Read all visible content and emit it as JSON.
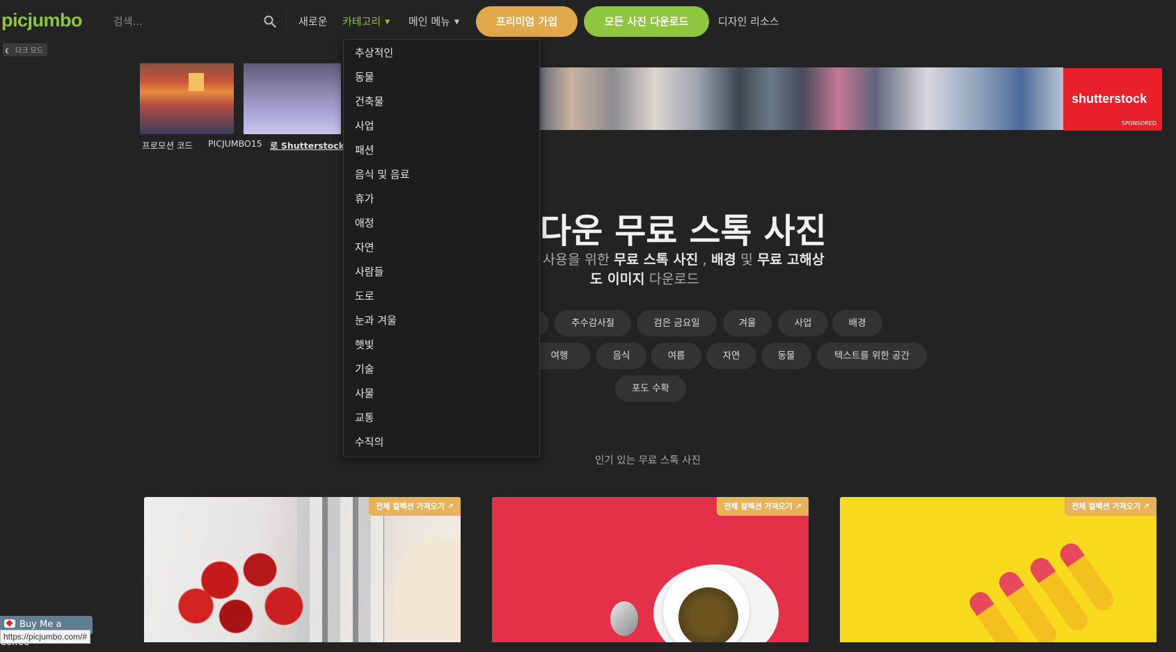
{
  "header": {
    "logo": "picjumbo",
    "dark_mode_label": "다크 모드",
    "search_placeholder": "검색...",
    "nav": {
      "new": "새로운",
      "categories": "카테고리",
      "main_menu": "메인 메뉴",
      "design_resources": "디자인 리소스"
    },
    "premium_button": "프리미엄 가입",
    "download_all_button": "모든 사진 다운로드"
  },
  "promo": {
    "labels": [
      "프로모션 코드",
      "PICJUMBO15",
      "로 Shutterstock에"
    ],
    "shutterstock_logo": "shutterstock",
    "sponsored": "SPONSORED"
  },
  "hero": {
    "title": "다운 무료 스톡 사진",
    "subtitle_parts": [
      "사용을 위한",
      "무료 스톡 사진",
      ",",
      "배경",
      "및",
      "무료 고해상",
      "도 이미지",
      "다운로드"
    ]
  },
  "tags": {
    "row1": [
      "추수감사절",
      "검은 금요일",
      "겨울",
      "사업",
      "배경"
    ],
    "row2": [
      "여행",
      "음식",
      "여름",
      "자연",
      "동물",
      "텍스트를 위한 공간"
    ],
    "row3": [
      "포도 수확"
    ]
  },
  "popular_heading": "인기 있는 무료 스톡 사진",
  "cards": [
    {
      "badge": "전체 컬렉션 가져오기"
    },
    {
      "badge": "전체 컬렉션 가져오기"
    },
    {
      "badge": "전체 컬렉션 가져오기"
    }
  ],
  "category_menu": [
    "추상적인",
    "동물",
    "건축물",
    "사업",
    "패션",
    "음식 및 음료",
    "휴가",
    "애정",
    "자연",
    "사람들",
    "도로",
    "눈과 겨울",
    "햇빛",
    "기술",
    "사물",
    "교통",
    "수직의"
  ],
  "footer": {
    "coffee": "Buy Me a Coffee",
    "status_url": "https://picjumbo.com/#"
  },
  "colors": {
    "background": "#232323",
    "accent_green": "#8ec63f",
    "premium_orange": "#e0a94c",
    "shutterstock_red": "#e8202a"
  }
}
